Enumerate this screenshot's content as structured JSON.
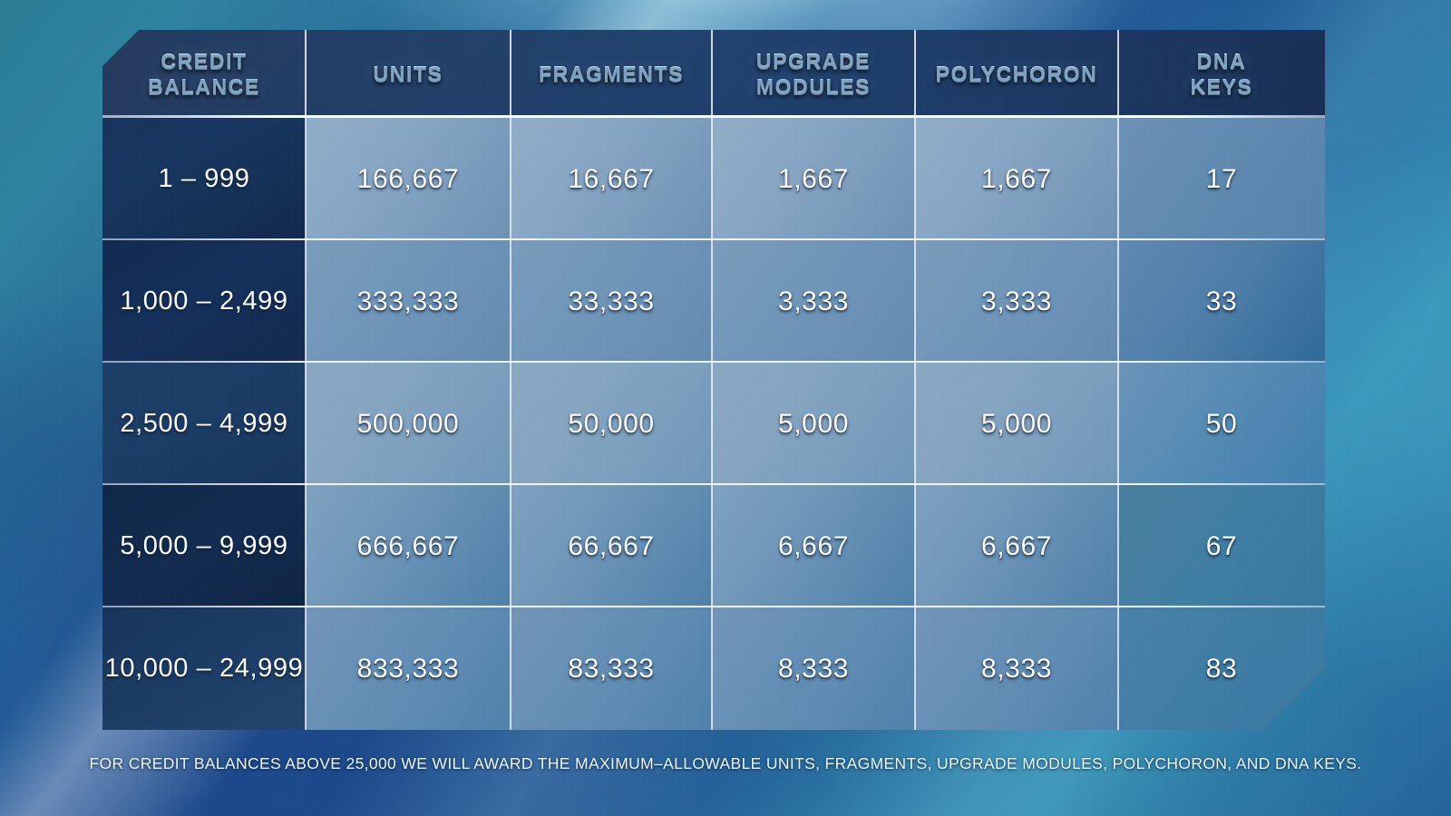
{
  "table": {
    "columns": [
      {
        "key": "credit_balance",
        "label": "CREDIT\nBALANCE"
      },
      {
        "key": "units",
        "label": "UNITS"
      },
      {
        "key": "fragments",
        "label": "FRAGMENTS"
      },
      {
        "key": "upgrade_modules",
        "label": "UPGRADE\nMODULES"
      },
      {
        "key": "polychoron",
        "label": "POLYCHORON"
      },
      {
        "key": "dna_keys",
        "label": "DNA\nKEYS"
      }
    ],
    "column_labels": {
      "c0_line1": "CREDIT",
      "c0_line2": "BALANCE",
      "c1": "UNITS",
      "c2": "FRAGMENTS",
      "c3_line1": "UPGRADE",
      "c3_line2": "MODULES",
      "c4": "POLYCHORON",
      "c5_line1": "DNA",
      "c5_line2": "KEYS"
    },
    "rows": [
      {
        "credit_balance": "1 – 999",
        "units": "166,667",
        "fragments": "16,667",
        "upgrade_modules": "1,667",
        "polychoron": "1,667",
        "dna_keys": "17"
      },
      {
        "credit_balance": "1,000 – 2,499",
        "units": "333,333",
        "fragments": "33,333",
        "upgrade_modules": "3,333",
        "polychoron": "3,333",
        "dna_keys": "33"
      },
      {
        "credit_balance": "2,500 – 4,999",
        "units": "500,000",
        "fragments": "50,000",
        "upgrade_modules": "5,000",
        "polychoron": "5,000",
        "dna_keys": "50"
      },
      {
        "credit_balance": "5,000 – 9,999",
        "units": "666,667",
        "fragments": "66,667",
        "upgrade_modules": "6,667",
        "polychoron": "6,667",
        "dna_keys": "67"
      },
      {
        "credit_balance": "10,000 – 24,999",
        "units": "833,333",
        "fragments": "83,333",
        "upgrade_modules": "8,333",
        "polychoron": "8,333",
        "dna_keys": "83"
      }
    ]
  },
  "footer": {
    "note": "FOR CREDIT BALANCES ABOVE 25,000 WE WILL AWARD THE MAXIMUM–ALLOWABLE UNITS, FRAGMENTS, UPGRADE MODULES, POLYCHORON, AND DNA KEYS."
  },
  "colors": {
    "header_bg": "#1a3a64",
    "first_column_bg": "#132f57",
    "data_cell_bg": "#7ea2c0",
    "grid_line": "#ffffff",
    "text": "#ffffff",
    "background_teal": "#2f83a0",
    "background_blue": "#1f4d8e"
  }
}
